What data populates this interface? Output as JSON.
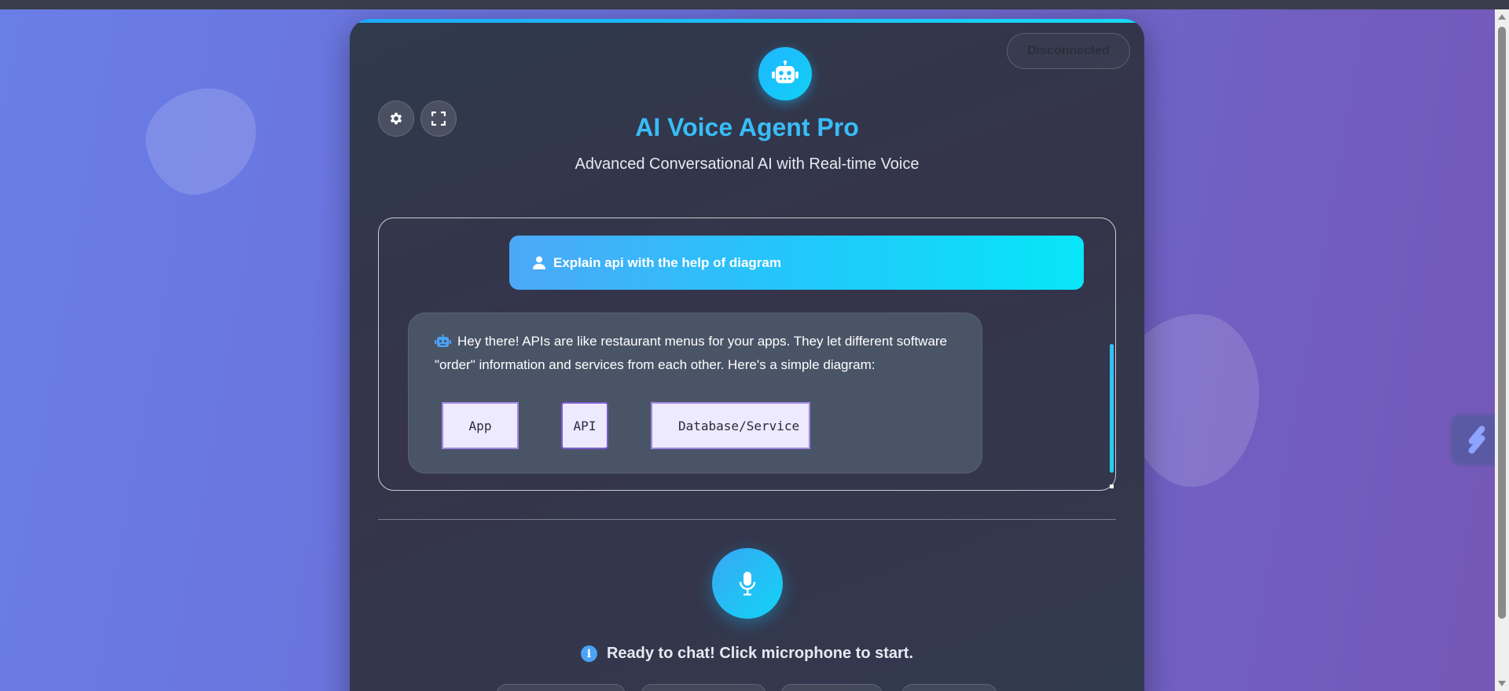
{
  "header": {
    "title": "AI Voice Agent Pro",
    "subtitle": "Advanced Conversational AI with Real-time Voice",
    "connection_status": "Disconnected",
    "logo_icon": "robot-icon",
    "settings_icon": "gear-icon",
    "fullscreen_icon": "expand-icon"
  },
  "conversation": {
    "messages": [
      {
        "role": "user",
        "icon": "user-icon",
        "text": "Explain api with the help of diagram"
      },
      {
        "role": "assistant",
        "icon": "robot-icon",
        "text": "Hey there! APIs are like restaurant menus for your apps. They let different software \"order\" information and services from each other. Here's a simple diagram:"
      }
    ],
    "diagram": {
      "nodes": [
        "App",
        "API",
        "Database/Service"
      ]
    }
  },
  "controls": {
    "mic_icon": "microphone-icon",
    "status_text": "Ready to chat! Click microphone to start.",
    "status_icon": "info-icon"
  },
  "colors": {
    "accent": "#38bdf8",
    "accent_cyan": "#06e6f8",
    "card_bg": "#2f3a4d",
    "page_gradient_start": "#6a7ee8",
    "page_gradient_end": "#7457b6"
  }
}
